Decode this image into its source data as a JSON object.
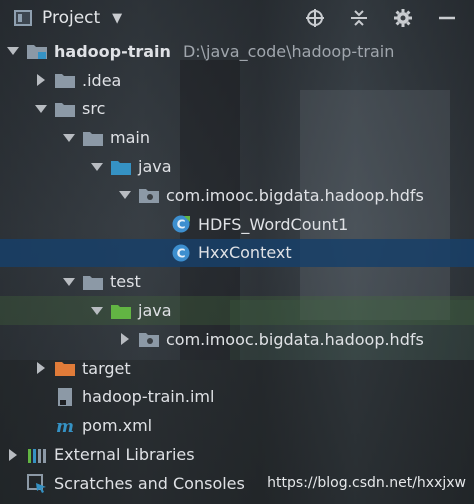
{
  "header": {
    "title": "Project",
    "caret": "▼"
  },
  "tree": {
    "root": {
      "label": "hadoop-train",
      "path": "D:\\java_code\\hadoop-train"
    },
    "idea": {
      "label": ".idea"
    },
    "src": {
      "label": "src"
    },
    "main": {
      "label": "main"
    },
    "main_java": {
      "label": "java"
    },
    "main_package": {
      "label": "com.imooc.bigdata.hadoop.hdfs"
    },
    "class_1": {
      "label": "HDFS_WordCount1"
    },
    "class_2": {
      "label": "HxxContext"
    },
    "test": {
      "label": "test"
    },
    "test_java": {
      "label": "java"
    },
    "test_package": {
      "label": "com.imooc.bigdata.hadoop.hdfs"
    },
    "target": {
      "label": "target"
    },
    "iml": {
      "label": "hadoop-train.iml"
    },
    "pom": {
      "label": "pom.xml"
    },
    "ext_libs": {
      "label": "External Libraries"
    },
    "scratches": {
      "label": "Scratches and Consoles"
    }
  },
  "watermark": "https://blog.csdn.net/hxxjxw",
  "colors": {
    "selection": "#173f68",
    "folder_gray": "#8c99a6",
    "folder_blue": "#3592c4",
    "folder_green": "#62b543",
    "folder_orange": "#e07b39",
    "class_icon": "#3d8fcf"
  }
}
